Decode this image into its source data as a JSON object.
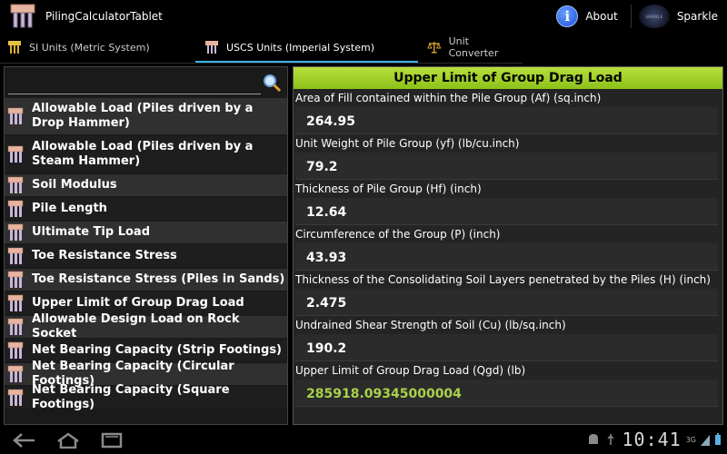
{
  "app": {
    "title": "PilingCalculatorTablet"
  },
  "actions": {
    "about_label": "About",
    "sparkle_label": "Sparkle",
    "sparkle_logo_text": "SPARKLE"
  },
  "tabs": [
    {
      "label": "SI Units (Metric System)",
      "icon": "pile-icon",
      "selected": false
    },
    {
      "label": "USCS Units (Imperial System)",
      "icon": "pile-icon",
      "selected": true
    },
    {
      "label": "Unit Converter",
      "icon": "scale-icon",
      "selected": false
    }
  ],
  "search": {
    "placeholder": "",
    "value": ""
  },
  "list": {
    "items": [
      {
        "label": "Allowable Load (Piles driven by a Drop Hammer)"
      },
      {
        "label": "Allowable Load (Piles driven by a Steam Hammer)"
      },
      {
        "label": "Soil Modulus"
      },
      {
        "label": "Pile Length"
      },
      {
        "label": "Ultimate Tip Load"
      },
      {
        "label": "Toe Resistance Stress"
      },
      {
        "label": "Toe Resistance Stress (Piles in Sands)"
      },
      {
        "label": "Upper Limit of Group Drag Load"
      },
      {
        "label": "Allowable Design Load on Rock Socket"
      },
      {
        "label": "Net Bearing Capacity (Strip Footings)"
      },
      {
        "label": "Net Bearing Capacity (Circular Footings)"
      },
      {
        "label": "Net Bearing Capacity (Square Footings)"
      }
    ]
  },
  "form": {
    "title": "Upper Limit of Group Drag Load",
    "fields": [
      {
        "label": "Area of Fill contained within the Pile Group (Af) (sq.inch)",
        "value": "264.95"
      },
      {
        "label": "Unit Weight of Pile Group (yf) (lb/cu.inch)",
        "value": "79.2"
      },
      {
        "label": "Thickness of Pile Group (Hf) (inch)",
        "value": "12.64"
      },
      {
        "label": "Circumference of the Group (P) (inch)",
        "value": "43.93"
      },
      {
        "label": "Thickness of the Consolidating Soil Layers penetrated by the Piles (H) (inch)",
        "value": "2.475"
      },
      {
        "label": "Undrained Shear Strength of Soil (Cu) (lb/sq.inch)",
        "value": "190.2"
      }
    ],
    "result": {
      "label": "Upper Limit of Group Drag Load (Qgd) (lb)",
      "value": "285918.09345000004"
    }
  },
  "status": {
    "time": "10:41",
    "network": "3G"
  },
  "colors": {
    "accent": "#33b5e5",
    "header_green": "#a5d12e",
    "result_green": "#a8d24a"
  }
}
